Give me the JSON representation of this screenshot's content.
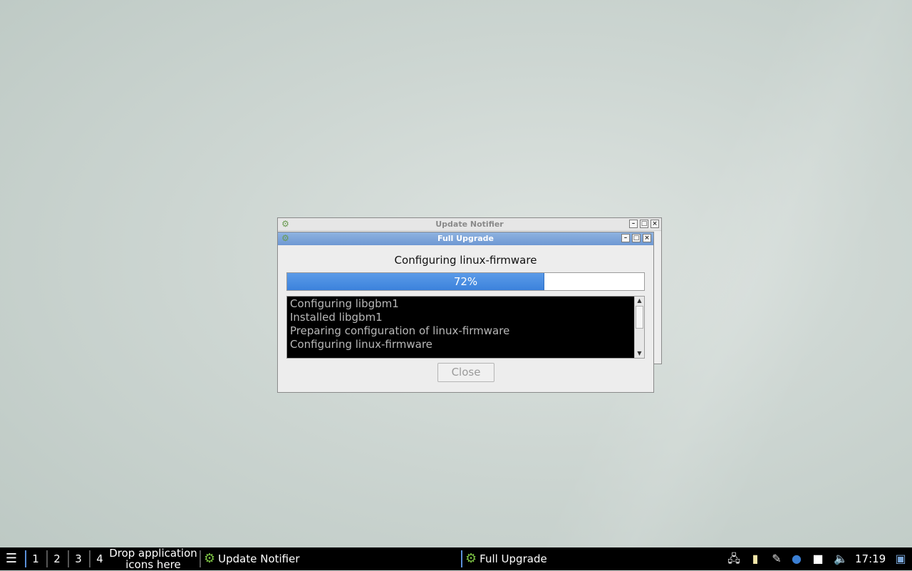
{
  "background_window": {
    "title": "Update Notifier"
  },
  "dialog": {
    "title": "Full Upgrade",
    "heading": "Configuring linux-firmware",
    "progress": {
      "percent": 72,
      "label": "72%"
    },
    "log_lines": [
      "Configuring libgbm1",
      "Installed libgbm1",
      "Preparing configuration of linux-firmware",
      "Configuring linux-firmware"
    ],
    "close_label": "Close"
  },
  "taskbar": {
    "workspaces": [
      "1",
      "2",
      "3",
      "4"
    ],
    "launcher_hint_line1": "Drop application",
    "launcher_hint_line2": "icons here",
    "tasks": [
      {
        "label": "Update Notifier",
        "icon": "gear-icon"
      },
      {
        "label": "Full Upgrade",
        "icon": "gear-icon"
      }
    ],
    "tray_icons": [
      "network-icon",
      "clipboard-icon",
      "tools-icon",
      "update-alert-icon",
      "notes-icon",
      "volume-icon",
      "show-desktop-icon"
    ],
    "clock": "17:19"
  },
  "colors": {
    "accent": "#3c82dc",
    "taskbar_bg": "#000000",
    "log_bg": "#000000"
  }
}
